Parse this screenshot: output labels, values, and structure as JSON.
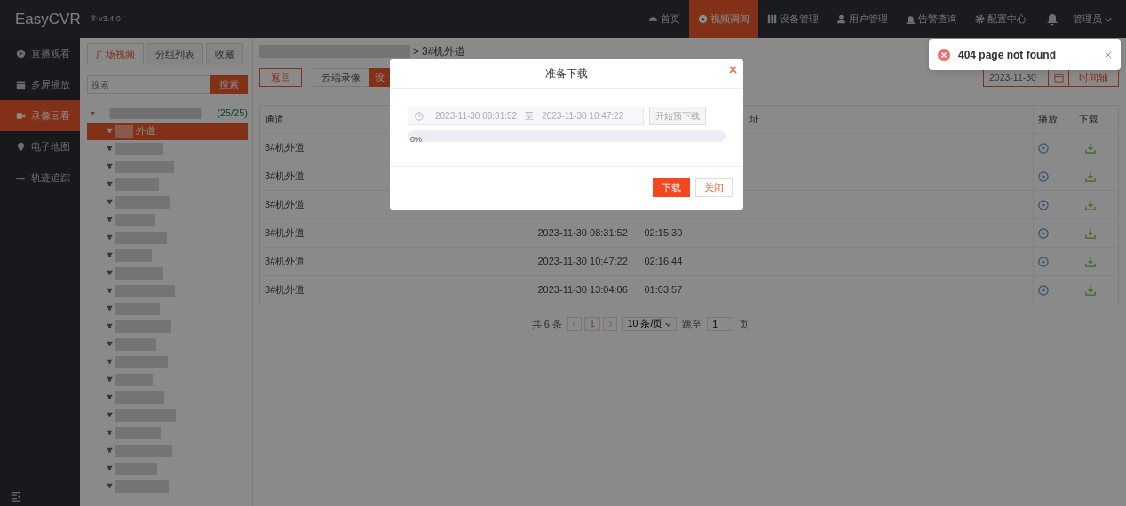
{
  "app": {
    "name": "EasyCVR",
    "version": "® v3.4.0"
  },
  "top_nav": [
    {
      "label": "首页",
      "selected": false
    },
    {
      "label": "视频调阅",
      "selected": true
    },
    {
      "label": "设备管理",
      "selected": false
    },
    {
      "label": "用户管理",
      "selected": false
    },
    {
      "label": "告警查询",
      "selected": false
    },
    {
      "label": "配置中心",
      "selected": false
    }
  ],
  "user": {
    "label": "管理员"
  },
  "sidebar": {
    "items": [
      {
        "label": "直播观看",
        "selected": false
      },
      {
        "label": "多屏播放",
        "selected": false
      },
      {
        "label": "录像回看",
        "selected": true
      },
      {
        "label": "电子地图",
        "selected": false
      },
      {
        "label": "轨迹追踪",
        "selected": false
      }
    ]
  },
  "tree_panel": {
    "tabs": [
      {
        "label": "广场视频",
        "selected": true
      },
      {
        "label": "分组列表",
        "selected": false
      },
      {
        "label": "收藏",
        "selected": false
      }
    ],
    "search": {
      "placeholder": "搜索",
      "button": "搜索"
    },
    "root": {
      "count": "(25/25)",
      "expanded": true,
      "children": [
        {
          "label": "外道",
          "selected": true
        },
        {
          "selected": false
        },
        {
          "selected": false
        },
        {
          "selected": false
        },
        {
          "selected": false
        },
        {
          "selected": false
        },
        {
          "selected": false
        },
        {
          "selected": false
        },
        {
          "selected": false
        },
        {
          "selected": false
        },
        {
          "selected": false
        },
        {
          "selected": false
        },
        {
          "selected": false
        },
        {
          "selected": false
        },
        {
          "selected": false
        },
        {
          "selected": false
        },
        {
          "selected": false
        },
        {
          "selected": false
        },
        {
          "selected": false
        },
        {
          "selected": false
        },
        {
          "selected": false
        }
      ]
    }
  },
  "breadcrumb": {
    "separator": ">",
    "current": "3#机外道"
  },
  "toolbar": {
    "back_button": "返回",
    "source_tabs": [
      {
        "label": "云端录像",
        "selected": false
      },
      {
        "label": "设",
        "selected": true
      }
    ],
    "date_field": {
      "value": "2023-11-30"
    },
    "timeline_button": "时间轴"
  },
  "table": {
    "columns": {
      "channel": "通道",
      "column_4": "址",
      "play": "播放",
      "download": "下载"
    },
    "rows": [
      {
        "channel": "3#机外道"
      },
      {
        "channel": "3#机外道"
      },
      {
        "channel": "3#机外道"
      },
      {
        "channel": "3#机外道",
        "start": "2023-11-30 08:31:52",
        "duration": "02:15:30"
      },
      {
        "channel": "3#机外道",
        "start": "2023-11-30 10:47:22",
        "duration": "02:16:44"
      },
      {
        "channel": "3#机外道",
        "start": "2023-11-30 13:04:06",
        "duration": "01:03:57"
      }
    ]
  },
  "pagination": {
    "total": "共 6 条",
    "pages": [
      {
        "label": "1",
        "selected": true
      }
    ],
    "page_size": "10 条/页",
    "jump_label": "跳至",
    "jump_value": "1",
    "page_suffix": "页"
  },
  "modal": {
    "title": "准备下载",
    "range": {
      "start": "2023-11-30 08:31:52",
      "separator": "至",
      "end": "2023-11-30 10:47:22"
    },
    "predownload_button": {
      "label": "开始预下载",
      "disabled": true
    },
    "progress": {
      "level": 0,
      "reading": "0%"
    },
    "buttons": [
      {
        "label": "下载",
        "kind": "primary"
      },
      {
        "label": "关闭",
        "kind": "secondary"
      }
    ]
  },
  "toast": {
    "kind": "error",
    "message": "404 page not found"
  }
}
